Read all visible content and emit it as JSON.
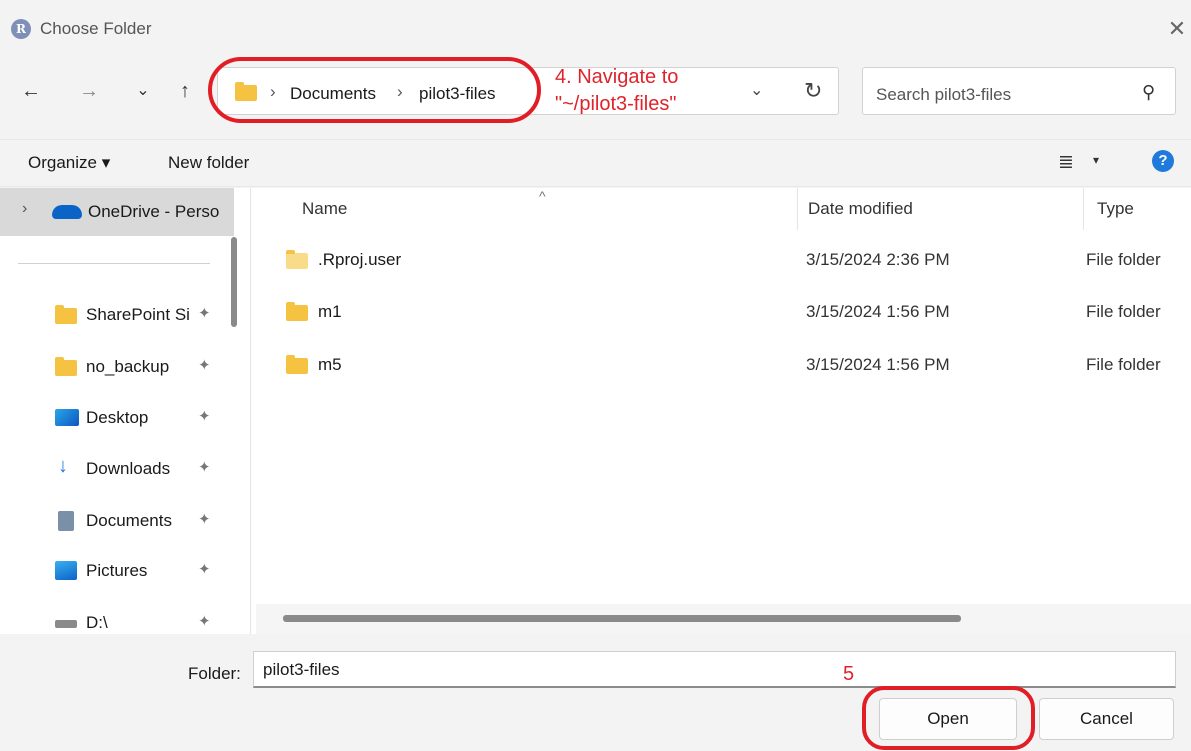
{
  "window": {
    "title": "Choose Folder",
    "app_icon": "R",
    "close_glyph": "✕"
  },
  "nav": {
    "back": "←",
    "forward": "→",
    "recent": "⌄",
    "up": "↑",
    "crumbs": [
      "Documents",
      "pilot3-files"
    ],
    "crumb_sep": "›",
    "refresh": "↻",
    "search_placeholder": "Search pilot3-files",
    "search_icon": "⚲"
  },
  "annotations": {
    "step4_line1": "4. Navigate to",
    "step4_line2": "\"~/pilot3-files\"",
    "step5": "5",
    "highlight_color": "#e11d25"
  },
  "toolbar": {
    "organize": "Organize ▾",
    "new_folder": "New folder",
    "view_icon": "≣",
    "view_drop": "▾",
    "help": "?"
  },
  "sidebar": {
    "onedrive": "OneDrive - Perso",
    "expand": "›",
    "items": [
      {
        "label": "SharePoint Si",
        "icon": "folder-icon"
      },
      {
        "label": "no_backup",
        "icon": "folder-icon"
      },
      {
        "label": "Desktop",
        "icon": "desktop-icon"
      },
      {
        "label": "Downloads",
        "icon": "download-icon"
      },
      {
        "label": "Documents",
        "icon": "document-icon"
      },
      {
        "label": "Pictures",
        "icon": "pictures-icon"
      },
      {
        "label": "D:\\",
        "icon": "drive-icon"
      }
    ],
    "pin": "📌"
  },
  "columns": {
    "name": "Name",
    "date": "Date modified",
    "type": "Type",
    "sort_caret": "^"
  },
  "files": [
    {
      "name": ".Rproj.user",
      "date": "3/15/2024 2:36 PM",
      "type": "File folder"
    },
    {
      "name": "m1",
      "date": "3/15/2024 1:56 PM",
      "type": "File folder"
    },
    {
      "name": "m5",
      "date": "3/15/2024 1:56 PM",
      "type": "File folder"
    }
  ],
  "footer": {
    "folder_label": "Folder:",
    "folder_value": "pilot3-files",
    "open": "Open",
    "cancel": "Cancel"
  }
}
